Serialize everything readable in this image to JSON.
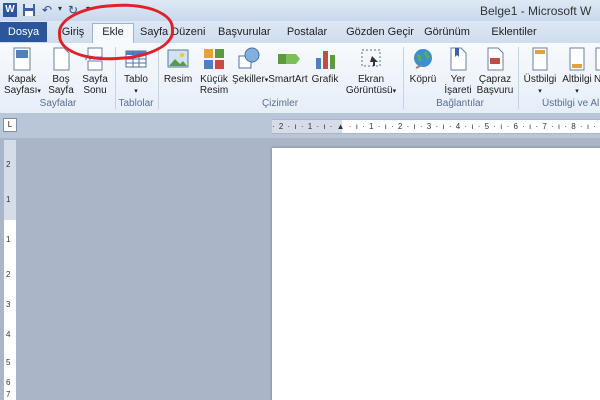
{
  "titlebar": {
    "app_icon": "W",
    "save_icon": "save-icon",
    "undo_icon": "undo-icon",
    "redo_icon": "redo-icon",
    "title": "Belge1 - Microsoft W"
  },
  "tabs": {
    "file": "Dosya",
    "items": [
      "Giriş",
      "Ekle",
      "Sayfa Düzeni",
      "Başvurular",
      "Postalar",
      "Gözden Geçir",
      "Görünüm",
      "Eklentiler"
    ],
    "active": "Ekle"
  },
  "ribbon": {
    "groups": {
      "pages": "Sayfalar",
      "tables": "Tablolar",
      "illustrations": "Çizimler",
      "links": "Bağlantılar",
      "header_footer": "Üstbilgi ve Al"
    },
    "buttons": {
      "cover_page": [
        "Kapak",
        "Sayfası"
      ],
      "blank_page": [
        "Boş",
        "Sayfa"
      ],
      "page_break": [
        "Sayfa",
        "Sonu"
      ],
      "table": [
        "Tablo"
      ],
      "picture": [
        "Resim"
      ],
      "clipart": [
        "Küçük",
        "Resim"
      ],
      "shapes": [
        "Şekiller"
      ],
      "smartart": [
        "SmartArt"
      ],
      "chart": [
        "Grafik"
      ],
      "screenshot": [
        "Ekran",
        "Görüntüsü"
      ],
      "hyperlink": [
        "Köprü"
      ],
      "bookmark": [
        "Yer",
        "İşareti"
      ],
      "cross_reference": [
        "Çapraz",
        "Başvuru"
      ],
      "header": [
        "Üstbilgi"
      ],
      "footer": [
        "Altbilgi"
      ],
      "page_number": [
        "N"
      ]
    }
  },
  "ruler": {
    "h_ticks": "· 2 · ı · 1 · ı · ▲ · ı · 1 · ı · 2 · ı · 3 · ı · 4 · ı · 5 · ı · 6 · ı · 7 · ı · 8 · ı · 9",
    "v_numbers": [
      "2",
      "1",
      "1",
      "2",
      "3",
      "4",
      "5",
      "6",
      "7"
    ]
  },
  "colors": {
    "accent": "#2b579a",
    "annotation": "#e0202a"
  }
}
